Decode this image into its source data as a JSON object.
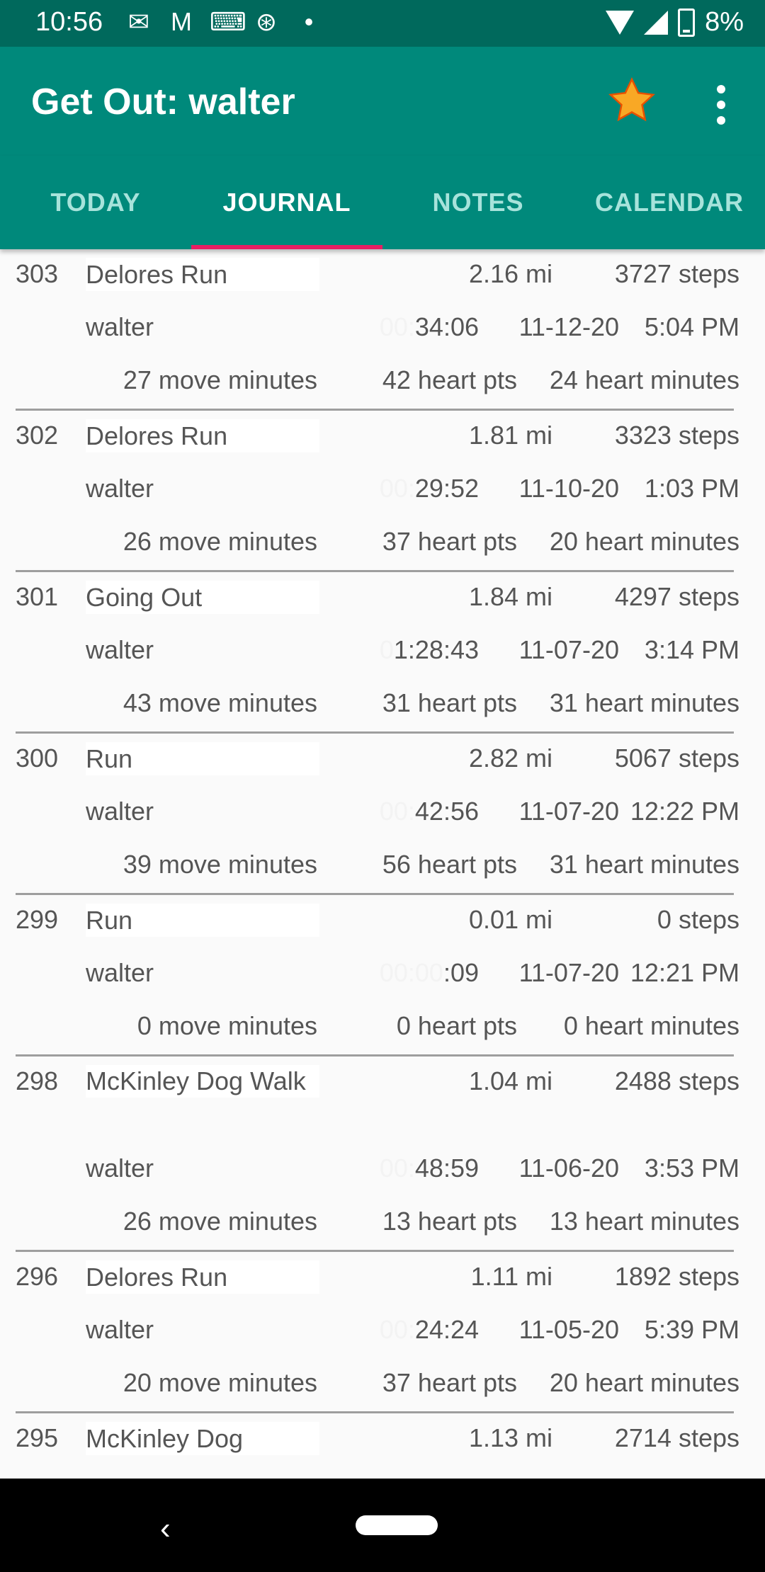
{
  "status_bar": {
    "time": "10:56",
    "icons": [
      "mail-icon",
      "gmail-icon",
      "keyboard-icon",
      "sync-icon",
      "dot-icon"
    ],
    "battery": "8%"
  },
  "app_bar": {
    "title": "Get Out: walter",
    "star_color": "#f9a825"
  },
  "tabs": [
    {
      "label": "TODAY",
      "active": false
    },
    {
      "label": "JOURNAL",
      "active": true
    },
    {
      "label": "NOTES",
      "active": false
    },
    {
      "label": "CALENDAR",
      "active": false
    }
  ],
  "entries": [
    {
      "id": "303",
      "name": "Delores Run",
      "distance": "2.16 mi",
      "steps": "3727 steps",
      "user": "walter",
      "duration_hidden": "00:",
      "duration": "34:06",
      "date": "11-12-20",
      "time": "5:04 PM",
      "move_minutes": "27 move minutes",
      "heart_pts": "42 heart pts",
      "heart_minutes": "24 heart minutes"
    },
    {
      "id": "302",
      "name": "Delores Run",
      "distance": "1.81 mi",
      "steps": "3323 steps",
      "user": "walter",
      "duration_hidden": "00:",
      "duration": "29:52",
      "date": "11-10-20",
      "time": "1:03 PM",
      "move_minutes": "26 move minutes",
      "heart_pts": "37 heart pts",
      "heart_minutes": "20 heart minutes"
    },
    {
      "id": "301",
      "name": "Going Out",
      "distance": "1.84 mi",
      "steps": "4297 steps",
      "user": "walter",
      "duration_hidden": "0",
      "duration": "1:28:43",
      "date": "11-07-20",
      "time": "3:14 PM",
      "move_minutes": "43 move minutes",
      "heart_pts": "31 heart pts",
      "heart_minutes": "31 heart minutes"
    },
    {
      "id": "300",
      "name": "Run",
      "distance": "2.82 mi",
      "steps": "5067 steps",
      "user": "walter",
      "duration_hidden": "00:",
      "duration": "42:56",
      "date": "11-07-20",
      "time": "12:22 PM",
      "move_minutes": "39 move minutes",
      "heart_pts": "56 heart pts",
      "heart_minutes": "31 heart minutes"
    },
    {
      "id": "299",
      "name": "Run",
      "distance": "0.01 mi",
      "steps": "0 steps",
      "user": "walter",
      "duration_hidden": "00:00",
      "duration": ":09",
      "date": "11-07-20",
      "time": "12:21 PM",
      "move_minutes": "0 move minutes",
      "heart_pts": "0 heart pts",
      "heart_minutes": "0 heart minutes"
    },
    {
      "id": "298",
      "name": "McKinley Dog Walk",
      "distance": "1.04 mi",
      "steps": "2488 steps",
      "user": "walter",
      "duration_hidden": "00:",
      "duration": "48:59",
      "date": "11-06-20",
      "time": "3:53 PM",
      "move_minutes": "26 move minutes",
      "heart_pts": "13 heart pts",
      "heart_minutes": "13 heart minutes"
    },
    {
      "id": "296",
      "name": "Delores Run",
      "distance": "1.11 mi",
      "steps": "1892 steps",
      "user": "walter",
      "duration_hidden": "00:",
      "duration": "24:24",
      "date": "11-05-20",
      "time": "5:39 PM",
      "move_minutes": "20 move minutes",
      "heart_pts": "37 heart pts",
      "heart_minutes": "20 heart minutes"
    },
    {
      "id": "295",
      "name": "McKinley Dog",
      "distance": "1.13 mi",
      "steps": "2714 steps",
      "user": "",
      "duration_hidden": "",
      "duration": "",
      "date": "",
      "time": "",
      "move_minutes": "",
      "heart_pts": "",
      "heart_minutes": ""
    }
  ]
}
